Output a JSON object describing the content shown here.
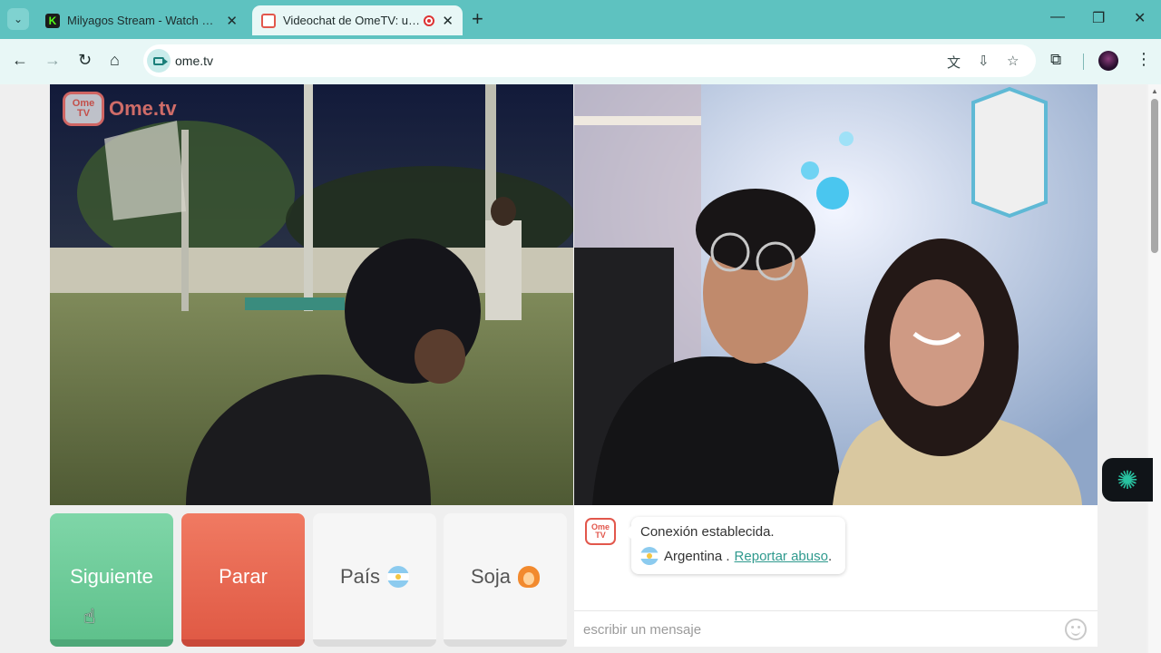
{
  "browser": {
    "tabs": [
      {
        "title": "Milyagos Stream - Watch Live o",
        "active": false,
        "favicon": "kick-logo"
      },
      {
        "title": "Videochat de OmeTV: una a",
        "active": true,
        "favicon": "ometv-logo",
        "recording": true
      }
    ],
    "kick_letter": "K",
    "url": "ome.tv",
    "icons": {
      "tab_search": "chevron-down-icon",
      "close": "close-icon",
      "new_tab": "plus-icon",
      "back": "back-arrow-icon",
      "forward": "forward-arrow-icon",
      "reload": "reload-icon",
      "home": "home-icon",
      "translate": "translate-icon",
      "install": "install-app-icon",
      "bookmark": "star-icon",
      "extensions": "puzzle-icon",
      "menu": "kebab-menu-icon"
    },
    "glyphs": {
      "tab_search": "⌄",
      "close": "✕",
      "new_tab": "+",
      "minimize": "—",
      "restore": "❐",
      "window_close": "✕",
      "back": "←",
      "forward": "→",
      "reload": "↻",
      "home": "⌂",
      "translate": "文",
      "install": "⇩",
      "bookmark": "☆",
      "extensions": "⧉",
      "menu": "⋮",
      "scroll_up": "▲"
    }
  },
  "ometv": {
    "logo_box_top": "Ome",
    "logo_box_bottom": "TV",
    "logo_text": "Ome.tv",
    "buttons": {
      "next": "Siguiente",
      "stop": "Parar",
      "country": "País",
      "gender": "Soja"
    },
    "chat": {
      "avatar_top": "Ome",
      "avatar_bottom": "TV",
      "status": "Conexión establecida.",
      "country": "Argentina .",
      "report": "Reportar abuso",
      "report_suffix": ".",
      "input_placeholder": "escribir un mensaje"
    }
  },
  "colors": {
    "browser_frame": "#5ec2c0",
    "next_button": "#6fcc98",
    "stop_button": "#e8674f",
    "link": "#2f9a8e"
  }
}
